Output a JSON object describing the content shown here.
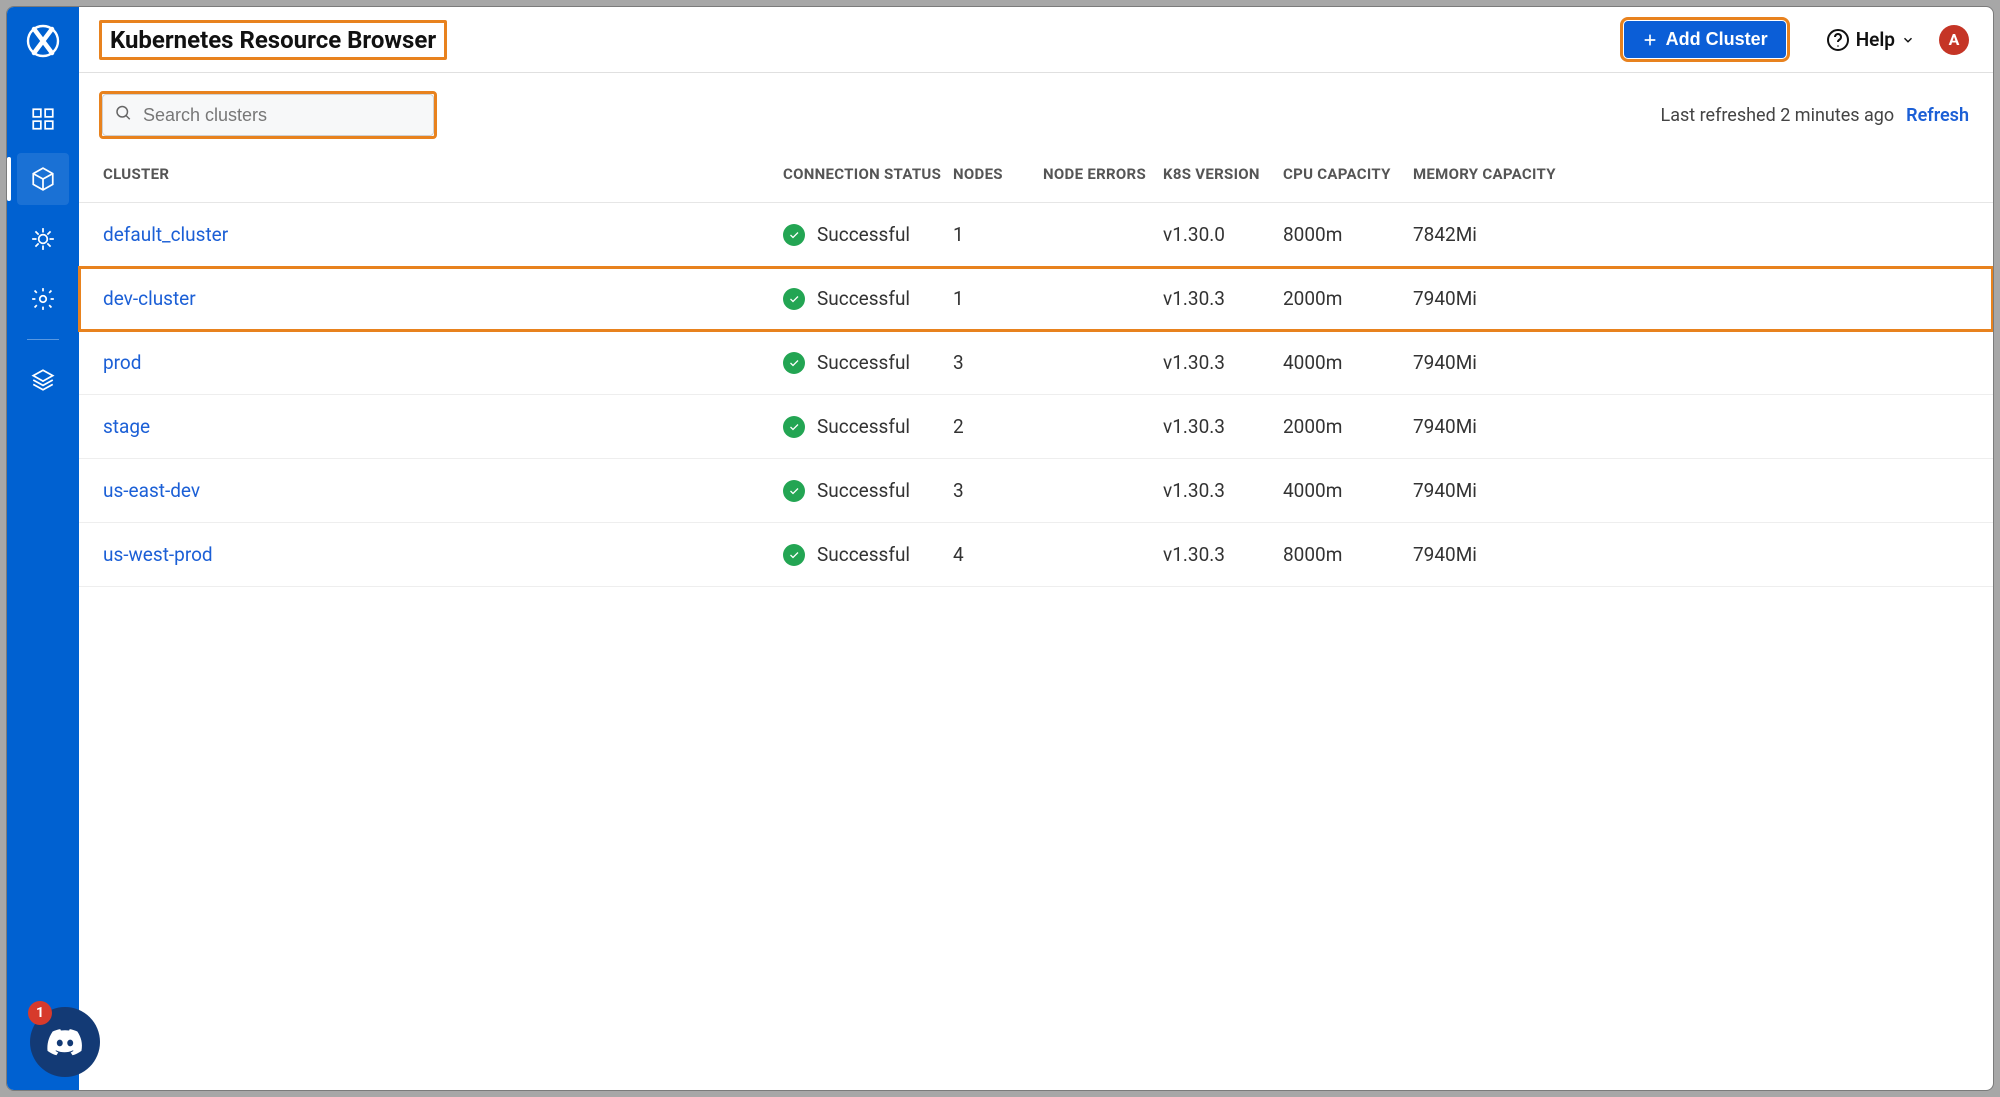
{
  "header": {
    "title": "Kubernetes Resource Browser",
    "add_cluster_label": "Add Cluster",
    "help_label": "Help",
    "avatar_letter": "A"
  },
  "toolbar": {
    "search_placeholder": "Search clusters",
    "last_refreshed": "Last refreshed 2 minutes ago",
    "refresh_label": "Refresh"
  },
  "columns": {
    "cluster": "Cluster",
    "connection_status": "Connection Status",
    "nodes": "Nodes",
    "node_errors": "Node Errors",
    "k8s_version": "K8s Version",
    "cpu_capacity": "CPU Capacity",
    "memory_capacity": "Memory Capacity"
  },
  "rows": [
    {
      "name": "default_cluster",
      "status": "Successful",
      "nodes": "1",
      "errors": "",
      "version": "v1.30.0",
      "cpu": "8000m",
      "mem": "7842Mi",
      "highlight": false
    },
    {
      "name": "dev-cluster",
      "status": "Successful",
      "nodes": "1",
      "errors": "",
      "version": "v1.30.3",
      "cpu": "2000m",
      "mem": "7940Mi",
      "highlight": true
    },
    {
      "name": "prod",
      "status": "Successful",
      "nodes": "3",
      "errors": "",
      "version": "v1.30.3",
      "cpu": "4000m",
      "mem": "7940Mi",
      "highlight": false
    },
    {
      "name": "stage",
      "status": "Successful",
      "nodes": "2",
      "errors": "",
      "version": "v1.30.3",
      "cpu": "2000m",
      "mem": "7940Mi",
      "highlight": false
    },
    {
      "name": "us-east-dev",
      "status": "Successful",
      "nodes": "3",
      "errors": "",
      "version": "v1.30.3",
      "cpu": "4000m",
      "mem": "7940Mi",
      "highlight": false
    },
    {
      "name": "us-west-prod",
      "status": "Successful",
      "nodes": "4",
      "errors": "",
      "version": "v1.30.3",
      "cpu": "8000m",
      "mem": "7940Mi",
      "highlight": false
    }
  ],
  "chat_badge": "1"
}
